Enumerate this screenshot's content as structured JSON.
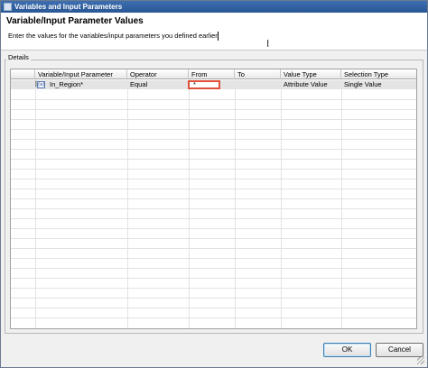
{
  "window": {
    "title": "Variables and Input Parameters"
  },
  "header": {
    "heading": "Variable/Input Parameter Values",
    "description": "Enter the values for the variables/input parameters you defined earlier"
  },
  "details": {
    "legend": "Details",
    "columns": [
      "Variable/Input Parameter",
      "Operator",
      "From",
      "To",
      "Value Type",
      "Selection Type"
    ],
    "rows": [
      {
        "variable": "In_Region*",
        "operator": "Equal",
        "from": "*",
        "to": "",
        "value_type": "Attribute Value",
        "selection_type": "Single Value"
      }
    ]
  },
  "buttons": {
    "ok": "OK",
    "cancel": "Cancel"
  },
  "colors": {
    "title_bar": "#2a5694",
    "highlight_border": "#e0503a",
    "selected_row": "#e4e4e4"
  },
  "icons": {
    "variable": "variable-icon",
    "app": "window-icon"
  }
}
